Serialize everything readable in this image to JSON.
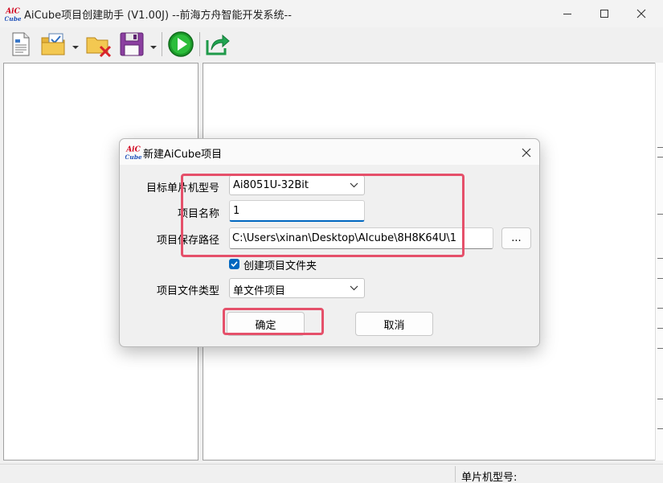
{
  "window": {
    "title": "AiCube项目创建助手 (V1.00J) --前海方舟智能开发系统--",
    "logo_text_top": "AiC",
    "logo_text_bottom": "Cube"
  },
  "toolbar": {
    "icons": [
      "new-file-icon",
      "open-project-icon",
      "close-project-icon",
      "save-icon",
      "run-icon",
      "export-icon"
    ]
  },
  "statusbar": {
    "mcu_label": "单片机型号:"
  },
  "dialog": {
    "title": "新建AiCube项目",
    "logo_text_top": "AiC",
    "logo_text_bottom": "Cube",
    "mcu_label": "目标单片机型号",
    "mcu_value": "Ai8051U-32Bit",
    "name_label": "项目名称",
    "name_value": "1",
    "path_label": "项目保存路径",
    "path_value": "C:\\Users\\xinan\\Desktop\\AIcube\\8H8K64U\\1",
    "browse_label": "...",
    "create_folder_label": "创建项目文件夹",
    "create_folder_checked": true,
    "filetype_label": "项目文件类型",
    "filetype_value": "单文件项目",
    "ok_label": "确定",
    "cancel_label": "取消"
  },
  "colors": {
    "accent": "#0067c0",
    "highlight": "#e5506a",
    "logo_red": "#d0021b",
    "logo_blue": "#1d4fb8"
  }
}
